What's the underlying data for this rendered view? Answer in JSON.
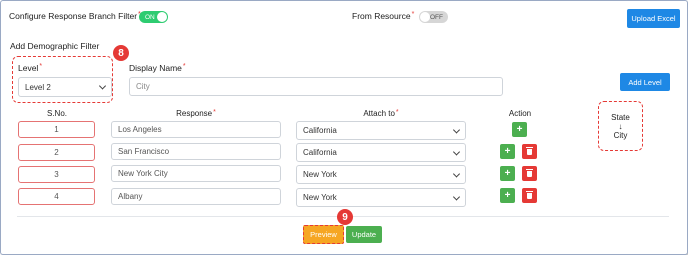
{
  "top": {
    "branch_filter_label": "Configure Response Branch Filter",
    "branch_filter_req": "*",
    "branch_toggle": "ON",
    "from_resource_label": "From Resource",
    "from_resource_req": "*",
    "resource_toggle": "OFF",
    "upload_excel": "Upload Excel"
  },
  "section_title": "Add Demographic Filter",
  "filter": {
    "level_label": "Level",
    "level_req": "*",
    "level_value": "Level 2",
    "display_name_label": "Display Name",
    "display_name_req": "*",
    "display_name_placeholder": "City",
    "add_level": "Add Level"
  },
  "badges": {
    "level_badge": "8",
    "preview_badge": "9"
  },
  "table": {
    "headers": {
      "sno": "S.No.",
      "response": "Response",
      "response_req": "*",
      "attach": "Attach to",
      "attach_req": "*",
      "action": "Action"
    },
    "rows": [
      {
        "sno": "1",
        "response": "Los Angeles",
        "attach": "California"
      },
      {
        "sno": "2",
        "response": "San Francisco",
        "attach": "California"
      },
      {
        "sno": "3",
        "response": "New York City",
        "attach": "New York"
      },
      {
        "sno": "4",
        "response": "Albany",
        "attach": "New York"
      }
    ]
  },
  "hierarchy": {
    "parent": "State",
    "arrow": "↓",
    "child": "City"
  },
  "footer": {
    "preview": "Preview",
    "update": "Update"
  },
  "colors": {
    "accent_blue": "#1e88e5",
    "toggle_green": "#2ecc71",
    "annotation_red": "#e53935",
    "preview_orange": "#f6a623"
  }
}
